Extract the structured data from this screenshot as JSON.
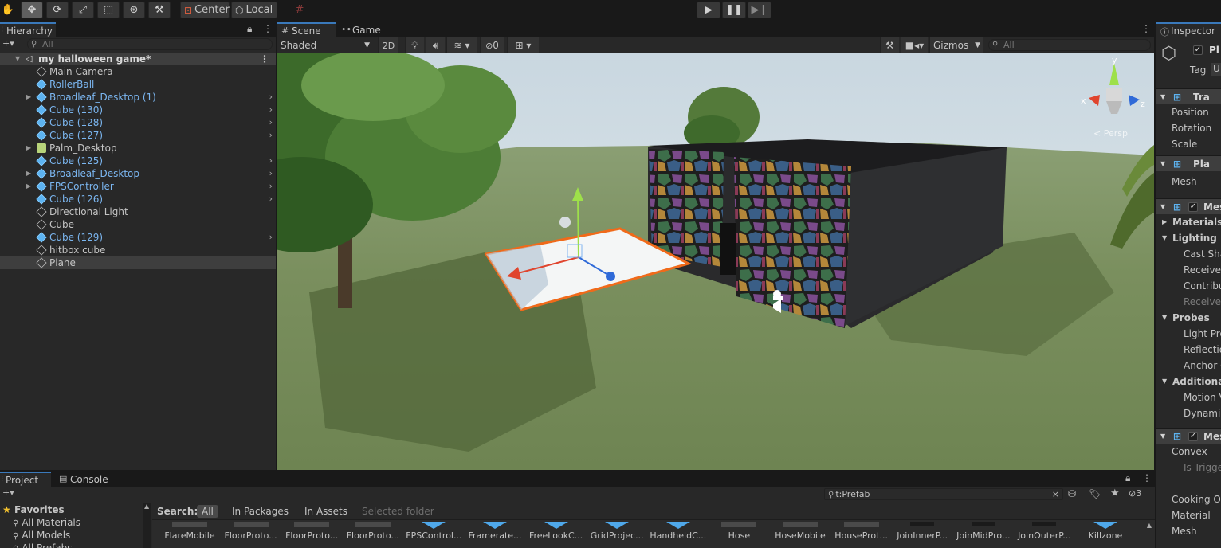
{
  "toolbar": {
    "pivot_label": "Center",
    "space_label": "Local"
  },
  "hierarchy": {
    "tab_label": "Hierarchy",
    "search_placeholder": "All",
    "scene_name": "my halloween game*",
    "items": [
      {
        "label": "Main Camera",
        "type": "object",
        "expandable": false
      },
      {
        "label": "RollerBall",
        "type": "prefab",
        "expandable": false
      },
      {
        "label": "Broadleaf_Desktop (1)",
        "type": "prefab",
        "expandable": true
      },
      {
        "label": "Cube (130)",
        "type": "prefab",
        "expandable": false
      },
      {
        "label": "Cube (128)",
        "type": "prefab",
        "expandable": false
      },
      {
        "label": "Cube (127)",
        "type": "prefab",
        "expandable": false
      },
      {
        "label": "Palm_Desktop",
        "type": "model",
        "expandable": true
      },
      {
        "label": "Cube (125)",
        "type": "prefab",
        "expandable": false
      },
      {
        "label": "Broadleaf_Desktop",
        "type": "prefab",
        "expandable": true
      },
      {
        "label": "FPSController",
        "type": "prefab",
        "expandable": true
      },
      {
        "label": "Cube (126)",
        "type": "prefab",
        "expandable": false
      },
      {
        "label": "Directional Light",
        "type": "object",
        "expandable": false
      },
      {
        "label": "Cube",
        "type": "object",
        "expandable": false
      },
      {
        "label": "Cube (129)",
        "type": "prefab",
        "expandable": false
      },
      {
        "label": "hitbox cube",
        "type": "object",
        "expandable": false
      },
      {
        "label": "Plane",
        "type": "object",
        "expandable": false,
        "selected": true
      }
    ]
  },
  "scene": {
    "tabs": [
      {
        "label": "Scene"
      },
      {
        "label": "Game"
      }
    ],
    "draw_mode": "Shaded",
    "mode_2d": "2D",
    "hidden_count": "0",
    "gizmos_label": "Gizmos",
    "search_placeholder": "All",
    "axes": {
      "y": "y",
      "x": "x",
      "z": "z"
    },
    "projection_label": "< Persp"
  },
  "inspector": {
    "tab_label": "Inspector",
    "object_name": "Pl",
    "tag_label": "Tag",
    "tag_value": "U",
    "rows": [
      {
        "label": "Tra",
        "kind": "component"
      },
      {
        "label": "Position",
        "kind": "prop"
      },
      {
        "label": "Rotation",
        "kind": "prop"
      },
      {
        "label": "Scale",
        "kind": "prop"
      },
      {
        "label": "Pla",
        "kind": "component"
      },
      {
        "label": "Mesh",
        "kind": "prop"
      },
      {
        "label": "Mes",
        "kind": "component"
      },
      {
        "label": "Materials",
        "kind": "section"
      },
      {
        "label": "Lighting",
        "kind": "section"
      },
      {
        "label": "Cast Sha",
        "kind": "subprop"
      },
      {
        "label": "Receive",
        "kind": "subprop"
      },
      {
        "label": "Contribu",
        "kind": "subprop"
      },
      {
        "label": "Receive",
        "kind": "subprop-dim"
      },
      {
        "label": "Probes",
        "kind": "section"
      },
      {
        "label": "Light Pro",
        "kind": "subprop"
      },
      {
        "label": "Reflectio",
        "kind": "subprop"
      },
      {
        "label": "Anchor O",
        "kind": "subprop"
      },
      {
        "label": "Additional",
        "kind": "section"
      },
      {
        "label": "Motion V",
        "kind": "subprop"
      },
      {
        "label": "Dynamic",
        "kind": "subprop"
      },
      {
        "label": "Mes",
        "kind": "component"
      },
      {
        "label": "Convex",
        "kind": "prop"
      },
      {
        "label": "Is Trigge",
        "kind": "subprop-dim"
      },
      {
        "label": "Cooking Op",
        "kind": "prop"
      },
      {
        "label": "Material",
        "kind": "prop"
      },
      {
        "label": "Mesh",
        "kind": "prop"
      }
    ]
  },
  "project": {
    "tabs": [
      {
        "label": "Project"
      },
      {
        "label": "Console"
      }
    ],
    "search_value": "t:Prefab",
    "hidden_packages_count": "3",
    "favorites_label": "Favorites",
    "favorites": [
      "All Materials",
      "All Models",
      "All Prefabs"
    ],
    "search_label": "Search:",
    "search_scopes": [
      {
        "label": "All",
        "state": "on"
      },
      {
        "label": "In Packages",
        "state": "normal"
      },
      {
        "label": "In Assets",
        "state": "normal"
      },
      {
        "label": "Selected folder",
        "state": "off"
      }
    ],
    "assets": [
      "FlareMobile",
      "FloorProto...",
      "FloorProto...",
      "FloorProto...",
      "FPSControl...",
      "Framerate...",
      "FreeLookC...",
      "GridProjec...",
      "HandheldC...",
      "Hose",
      "HoseMobile",
      "HouseProt...",
      "JoinInnerP...",
      "JoinMidPro...",
      "JoinOuterP...",
      "Killzone"
    ]
  }
}
